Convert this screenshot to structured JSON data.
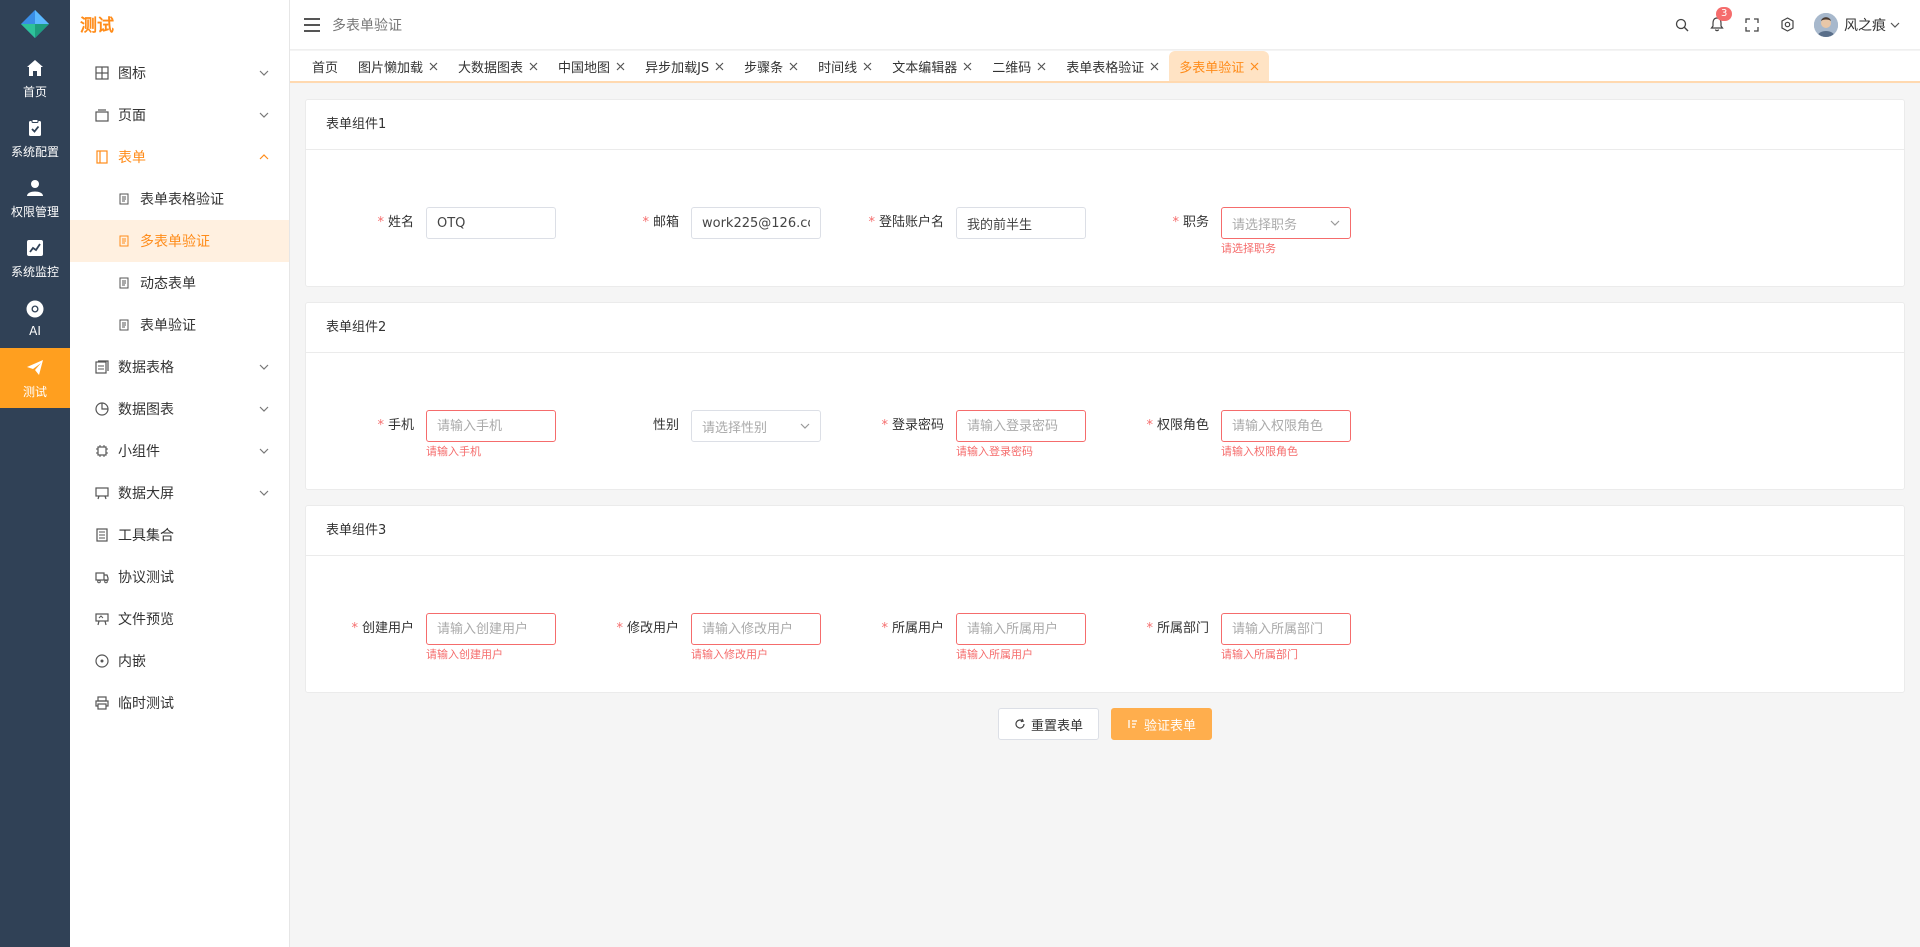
{
  "rail": {
    "items": [
      {
        "label": "首页",
        "icon": "home-icon"
      },
      {
        "label": "系统配置",
        "icon": "clipboard-icon"
      },
      {
        "label": "权限管理",
        "icon": "user-icon"
      },
      {
        "label": "系统监控",
        "icon": "chart-line-icon"
      },
      {
        "label": "AI",
        "icon": "chrome-icon"
      },
      {
        "label": "测试",
        "icon": "send-icon"
      }
    ],
    "active_color": "#ff9f1f",
    "bg_color": "#304156"
  },
  "submenu": {
    "title": "测试",
    "items": [
      {
        "label": "图标"
      },
      {
        "label": "页面"
      },
      {
        "label": "表单"
      },
      {
        "label": "表单表格验证"
      },
      {
        "label": "多表单验证"
      },
      {
        "label": "动态表单"
      },
      {
        "label": "表单验证"
      },
      {
        "label": "数据表格"
      },
      {
        "label": "数据图表"
      },
      {
        "label": "小组件"
      },
      {
        "label": "数据大屏"
      },
      {
        "label": "工具集合"
      },
      {
        "label": "协议测试"
      },
      {
        "label": "文件预览"
      },
      {
        "label": "内嵌"
      },
      {
        "label": "临时测试"
      }
    ]
  },
  "header": {
    "breadcrumb": "多表单验证",
    "notification_count": "3",
    "user_name": "风之痕"
  },
  "tabs": [
    {
      "label": "首页"
    },
    {
      "label": "图片懒加载"
    },
    {
      "label": "大数据图表"
    },
    {
      "label": "中国地图"
    },
    {
      "label": "异步加载JS"
    },
    {
      "label": "步骤条"
    },
    {
      "label": "时间线"
    },
    {
      "label": "文本编辑器"
    },
    {
      "label": "二维码"
    },
    {
      "label": "表单表格验证"
    },
    {
      "label": "多表单验证"
    }
  ],
  "forms": [
    {
      "title": "表单组件1",
      "fields": [
        {
          "label": "姓名",
          "value": "OTQ",
          "placeholder": "",
          "error": ""
        },
        {
          "label": "邮箱",
          "value": "work225@126.co",
          "placeholder": "",
          "error": ""
        },
        {
          "label": "登陆账户名",
          "value": "我的前半生",
          "placeholder": "",
          "error": ""
        },
        {
          "label": "职务",
          "value": "",
          "placeholder": "请选择职务",
          "error": "请选择职务"
        }
      ]
    },
    {
      "title": "表单组件2",
      "fields": [
        {
          "label": "手机",
          "value": "",
          "placeholder": "请输入手机",
          "error": "请输入手机"
        },
        {
          "label": "性别",
          "value": "",
          "placeholder": "请选择性别",
          "error": ""
        },
        {
          "label": "登录密码",
          "value": "",
          "placeholder": "请输入登录密码",
          "error": "请输入登录密码"
        },
        {
          "label": "权限角色",
          "value": "",
          "placeholder": "请输入权限角色",
          "error": "请输入权限角色"
        }
      ]
    },
    {
      "title": "表单组件3",
      "fields": [
        {
          "label": "创建用户",
          "value": "",
          "placeholder": "请输入创建用户",
          "error": "请输入创建用户"
        },
        {
          "label": "修改用户",
          "value": "",
          "placeholder": "请输入修改用户",
          "error": "请输入修改用户"
        },
        {
          "label": "所属用户",
          "value": "",
          "placeholder": "请输入所属用户",
          "error": "请输入所属用户"
        },
        {
          "label": "所属部门",
          "value": "",
          "placeholder": "请输入所属部门",
          "error": "请输入所属部门"
        }
      ]
    }
  ],
  "actions": {
    "reset_label": "重置表单",
    "submit_label": "验证表单"
  },
  "colors": {
    "accent": "#ff8c1a",
    "error": "#f56c6c",
    "primary_button": "#ffae4d"
  }
}
